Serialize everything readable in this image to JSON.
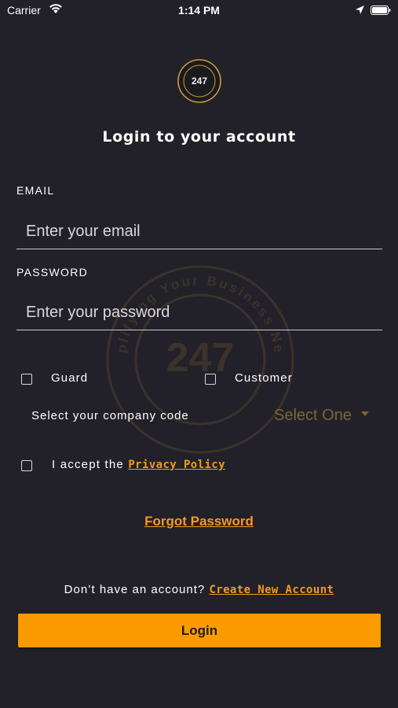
{
  "status_bar": {
    "carrier": "Carrier",
    "time": "1:14 PM"
  },
  "logo": {
    "text": "247"
  },
  "watermark": {
    "number": "247",
    "ring_text": "Simplifying Your Business Needs"
  },
  "title": "Login to your account",
  "email": {
    "label": "EMAIL",
    "placeholder": "Enter your email",
    "value": ""
  },
  "password": {
    "label": "PASSWORD",
    "placeholder": "Enter your password",
    "value": ""
  },
  "roles": [
    {
      "label": "Guard",
      "checked": false
    },
    {
      "label": "Customer",
      "checked": false
    }
  ],
  "company": {
    "label": "Select your company code",
    "select_value": "Select One"
  },
  "privacy": {
    "text": "I accept the",
    "link": "Privacy Policy",
    "checked": false
  },
  "forgot_password": "Forgot Password",
  "signup": {
    "text": "Don’t have an account?",
    "link": "Create New Account"
  },
  "login_button": "Login",
  "colors": {
    "background": "#222129",
    "accent": "#fb9b00",
    "link": "#f39a1e",
    "muted_gold": "#7a6634"
  }
}
